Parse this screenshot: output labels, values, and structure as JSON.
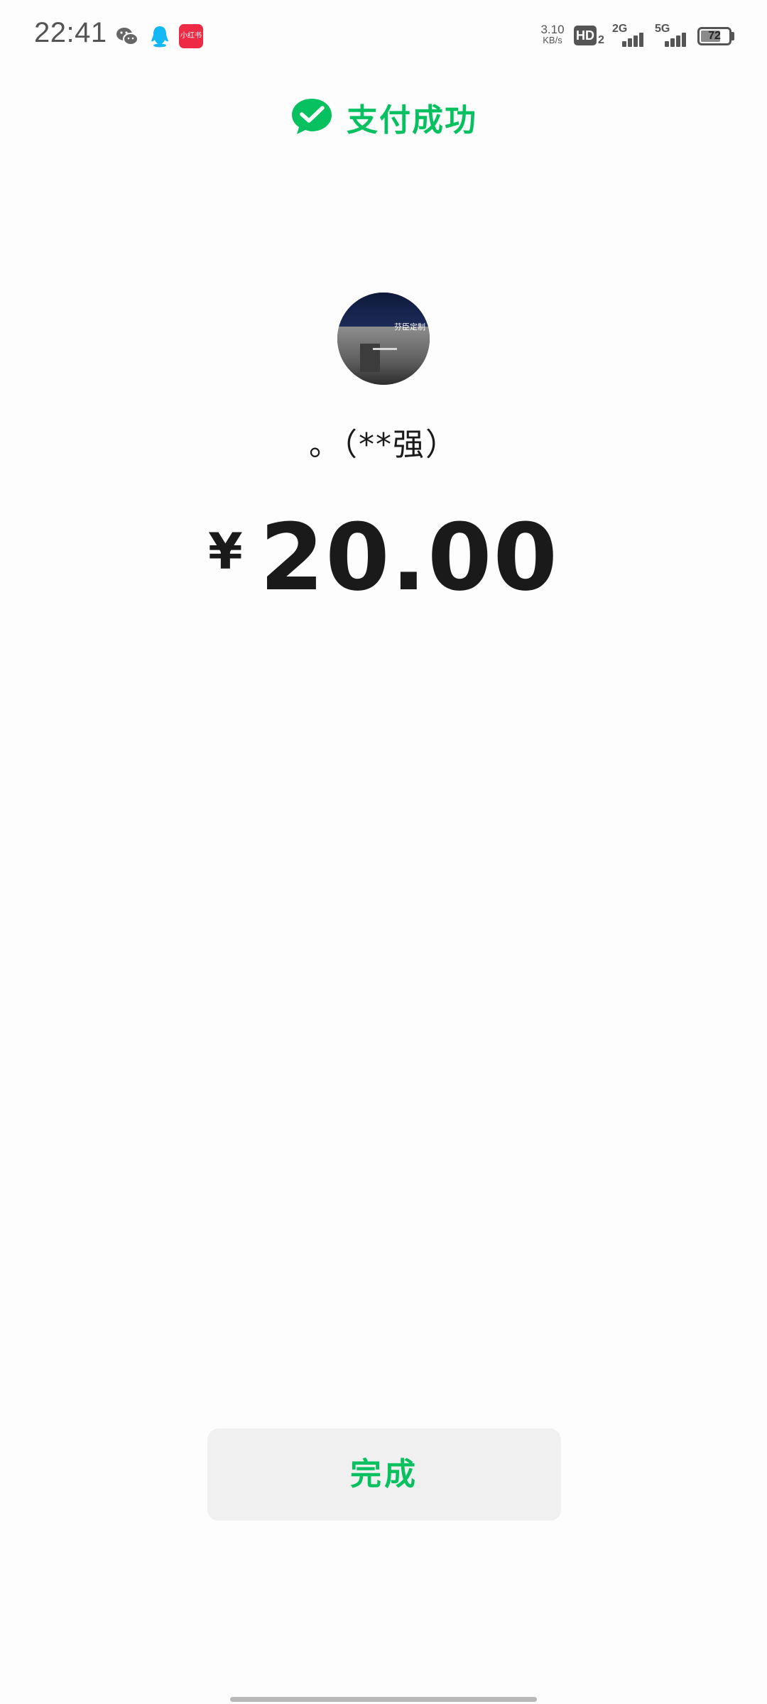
{
  "status_bar": {
    "time": "22:41",
    "notification_icons": [
      "wechat-icon",
      "qq-icon",
      "xiaohongshu-icon"
    ],
    "xiaohongshu_label": "小红书",
    "net_speed_value": "3.10",
    "net_speed_unit": "KB/s",
    "hd_label": "HD",
    "hd_sim": "2",
    "signal_1_label": "2G",
    "signal_2_label": "5G",
    "battery_level": "72",
    "battery_fraction": 0.72
  },
  "header": {
    "title": "支付成功",
    "accent_color": "#07c160"
  },
  "merchant": {
    "avatar_sign_text": "芬臣定制",
    "name": "。（**强）"
  },
  "payment": {
    "currency_symbol": "¥",
    "amount": "20.00"
  },
  "actions": {
    "done_label": "完成"
  }
}
